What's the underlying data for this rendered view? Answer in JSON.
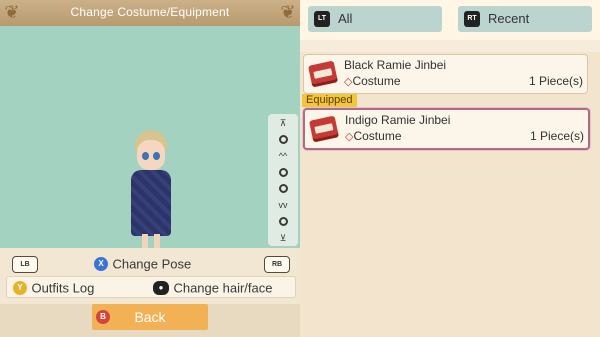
{
  "left_panel": {
    "title": "Change Costume/Equipment",
    "pose_controls": [
      "⊼",
      "•",
      "^^",
      "•",
      "•",
      "vv",
      "•",
      "⊻"
    ],
    "lb": "LB",
    "rb": "RB",
    "change_pose_btn": "X",
    "change_pose": "Change Pose",
    "outfits_btn": "Y",
    "outfits_log": "Outfits Log",
    "hair_btn": "●",
    "change_hair": "Change hair/face",
    "back_btn": "B",
    "back": "Back"
  },
  "right_panel": {
    "tabs": [
      {
        "key": "LT",
        "label": "All"
      },
      {
        "key": "RT",
        "label": "Recent"
      }
    ],
    "equipped_label": "Equipped",
    "items": [
      {
        "name": "Black Ramie Jinbei",
        "category": "Costume",
        "qty": "1 Piece(s)",
        "selected": false
      },
      {
        "name": "Indigo Ramie Jinbei",
        "category": "Costume",
        "qty": "1 Piece(s)",
        "selected": true
      }
    ]
  },
  "colors": {
    "stage_bg": "#a3d3c0",
    "title_bar": "#b99a6d",
    "tab_bg": "#bcd4cf",
    "equipped_badge": "#f1c63a",
    "back_button": "#f1b154",
    "selected_border": "#b06b84"
  }
}
